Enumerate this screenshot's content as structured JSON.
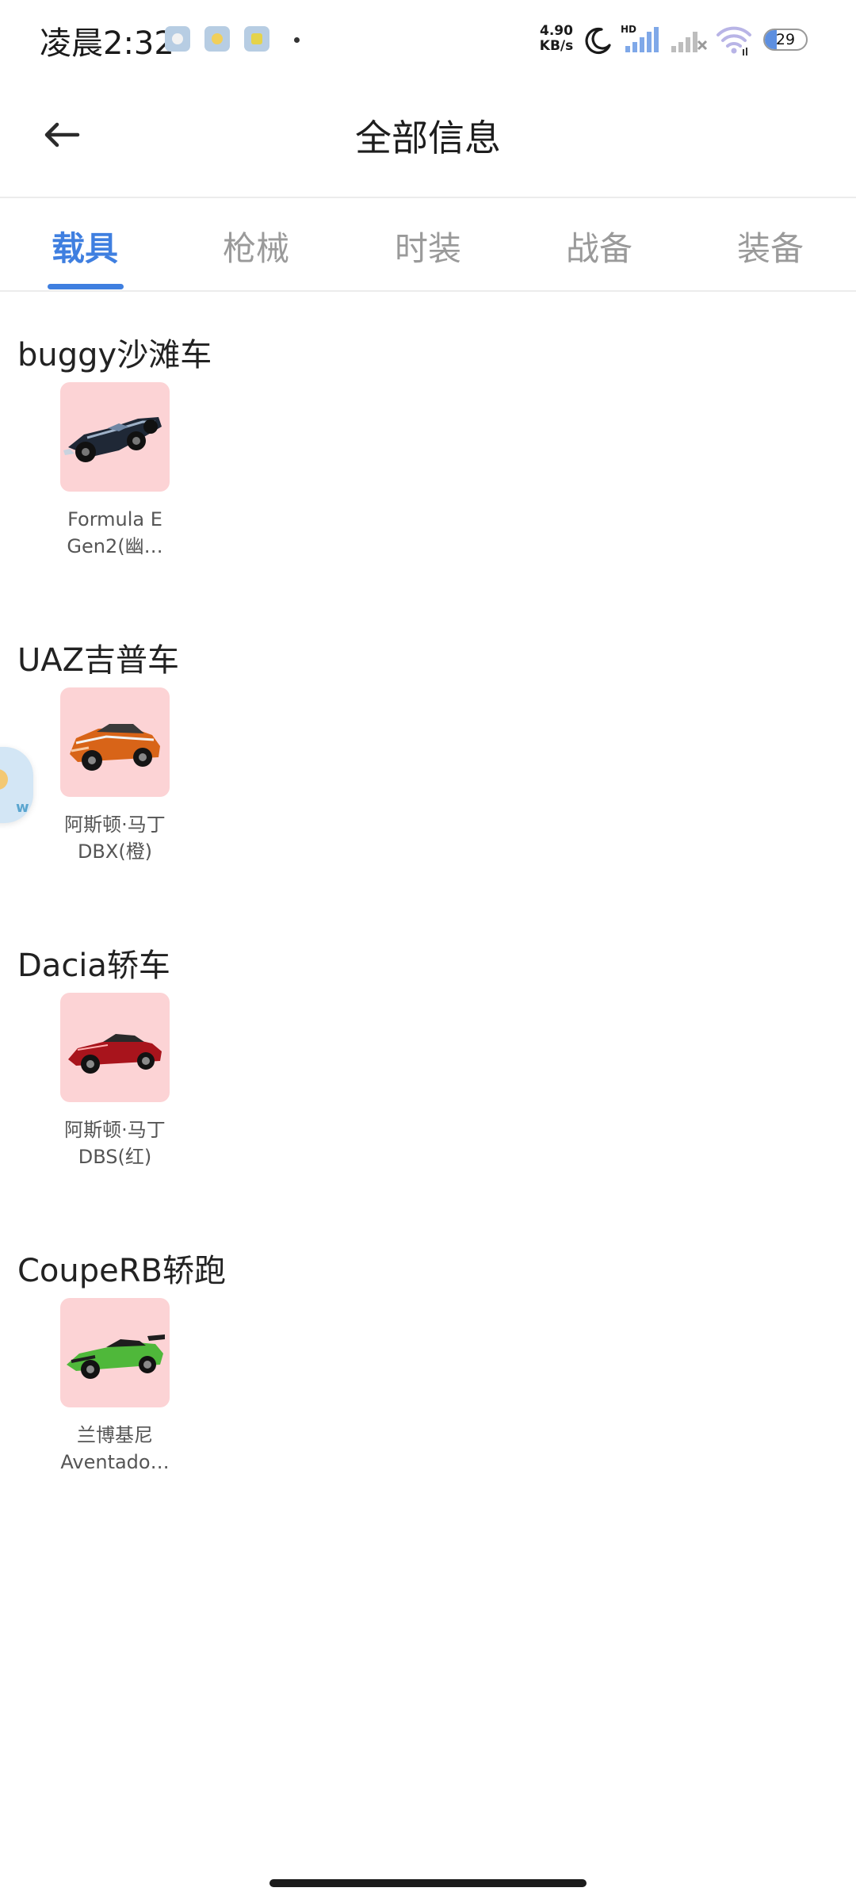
{
  "status_bar": {
    "time": "凌晨2:32",
    "net_speed_value": "4.90",
    "net_speed_unit": "KB/s",
    "network_type": "HD",
    "battery": "29"
  },
  "header": {
    "title": "全部信息"
  },
  "tabs": [
    {
      "label": "载具",
      "active": true
    },
    {
      "label": "枪械",
      "active": false
    },
    {
      "label": "时装",
      "active": false
    },
    {
      "label": "战备",
      "active": false
    },
    {
      "label": "装备",
      "active": false
    }
  ],
  "sections": [
    {
      "title": "buggy沙滩车",
      "item": {
        "line1": "Formula E",
        "line2": "Gen2(幽…"
      }
    },
    {
      "title": "UAZ吉普车",
      "item": {
        "line1": "阿斯顿·马丁",
        "line2": "DBX(橙)"
      }
    },
    {
      "title": "Dacia轿车",
      "item": {
        "line1": "阿斯顿·马丁",
        "line2": "DBS(红)"
      }
    },
    {
      "title": "CoupeRB轿跑",
      "item": {
        "line1": "兰博基尼",
        "line2": "Aventado…"
      }
    }
  ],
  "colors": {
    "accent": "#3f7fe0",
    "thumb_bg": "#fcd3d5",
    "tab_inactive": "#9a9a9a"
  },
  "icons": {
    "back": "arrow-left-icon",
    "moon": "moon-icon",
    "signal": "signal-icon",
    "wifi": "wifi-icon",
    "battery": "battery-icon"
  }
}
